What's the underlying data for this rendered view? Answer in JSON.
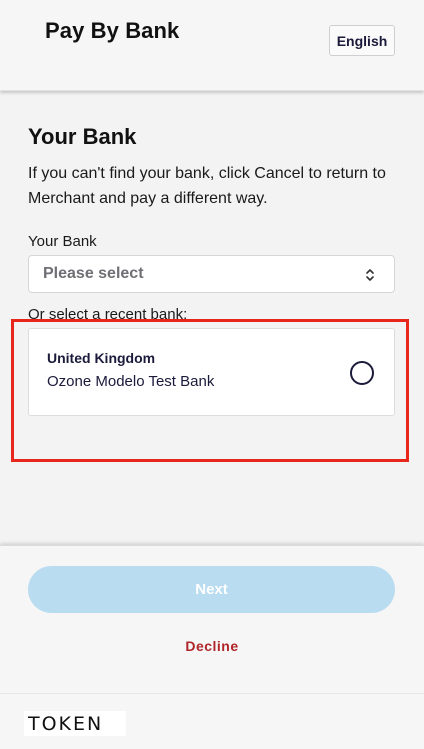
{
  "header": {
    "title": "Pay By Bank",
    "language_button": "English"
  },
  "main": {
    "section_title": "Your Bank",
    "instructions": "If you can't find your bank, click Cancel to return to Merchant and pay a different way.",
    "bank_field_label": "Your Bank",
    "bank_select_placeholder": "Please select",
    "recent_label": "Or select a recent bank:",
    "recent_banks": [
      {
        "country": "United Kingdom",
        "name": "Ozone Modelo Test Bank",
        "selected": false
      }
    ]
  },
  "footer": {
    "next_label": "Next",
    "decline_label": "Decline",
    "brand": "TOKEN"
  },
  "colors": {
    "primary_text": "#1b1a3b",
    "next_button_disabled": "#b9dcf1",
    "decline": "#b0252a",
    "highlight": "#e8261b"
  },
  "icons": {
    "select_indicator": "chevron-up-down-icon",
    "radio": "radio-unselected-icon"
  }
}
